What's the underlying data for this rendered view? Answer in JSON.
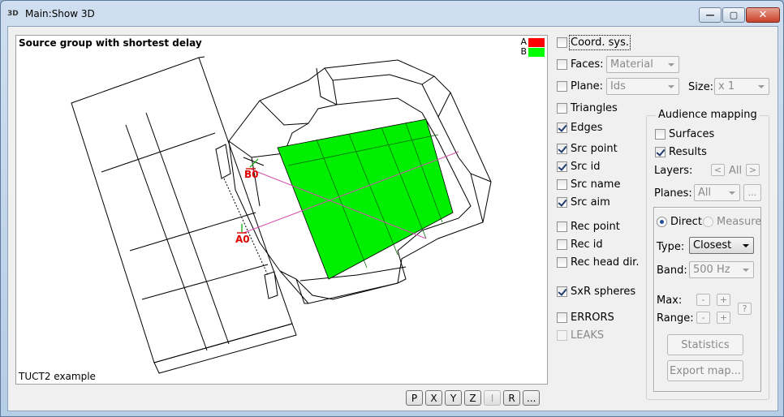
{
  "window": {
    "icon": "3D",
    "title": "Main:Show 3D",
    "controls": {
      "minimize": "—",
      "maximize": "▢",
      "close": "✕"
    }
  },
  "viewport": {
    "title": "Source group with shortest delay",
    "footer": "TUCT2 example",
    "legend": [
      {
        "label": "A",
        "color": "#ff0000"
      },
      {
        "label": "B",
        "color": "#00ff00"
      }
    ],
    "markers": {
      "b0": "B0",
      "a0": "A0"
    },
    "accent_fill": "#00ee00",
    "marker_color": "#dd0000",
    "ray_color": "#d64fb0"
  },
  "view_buttons": [
    {
      "label": "P",
      "enabled": true
    },
    {
      "label": "X",
      "enabled": true
    },
    {
      "label": "Y",
      "enabled": true
    },
    {
      "label": "Z",
      "enabled": true
    },
    {
      "label": "I",
      "enabled": false
    },
    {
      "label": "R",
      "enabled": true
    },
    {
      "label": "...",
      "enabled": true
    }
  ],
  "options": {
    "coord_sys": {
      "label": "Coord. sys.",
      "checked": false
    },
    "faces": {
      "label": "Faces:",
      "checked": false,
      "value": "Material"
    },
    "plane": {
      "label": "Plane:",
      "checked": false,
      "value": "Ids"
    },
    "size": {
      "label": "Size:",
      "value": "x 1"
    },
    "triangles": {
      "label": "Triangles",
      "checked": false
    },
    "edges": {
      "label": "Edges",
      "checked": true
    },
    "src_point": {
      "label": "Src point",
      "checked": true
    },
    "src_id": {
      "label": "Src id",
      "checked": true
    },
    "src_name": {
      "label": "Src name",
      "checked": false
    },
    "src_aim": {
      "label": "Src aim",
      "checked": true
    },
    "rec_point": {
      "label": "Rec point",
      "checked": false
    },
    "rec_id": {
      "label": "Rec id",
      "checked": false
    },
    "rec_head": {
      "label": "Rec head dir.",
      "checked": false
    },
    "sxr_spheres": {
      "label": "SxR spheres",
      "checked": true
    },
    "errors": {
      "label": "ERRORS",
      "checked": false
    },
    "leaks": {
      "label": "LEAKS",
      "checked": false
    }
  },
  "audience": {
    "title": "Audience mapping",
    "surfaces": {
      "label": "Surfaces",
      "checked": false
    },
    "results": {
      "label": "Results",
      "checked": true
    },
    "layers": {
      "label": "Layers:",
      "prev": "<",
      "value": "All",
      "next": ">"
    },
    "planes": {
      "label": "Planes:",
      "value": "All",
      "more": "..."
    },
    "direct": "Direct",
    "measure": "Measure",
    "type": {
      "label": "Type:",
      "value": "Closest"
    },
    "band": {
      "label": "Band:",
      "value": "500 Hz"
    },
    "max_label": "Max:",
    "range_label": "Range:",
    "minus": "-",
    "plus": "+",
    "help": "?",
    "statistics": "Statistics",
    "export_map": "Export map..."
  }
}
